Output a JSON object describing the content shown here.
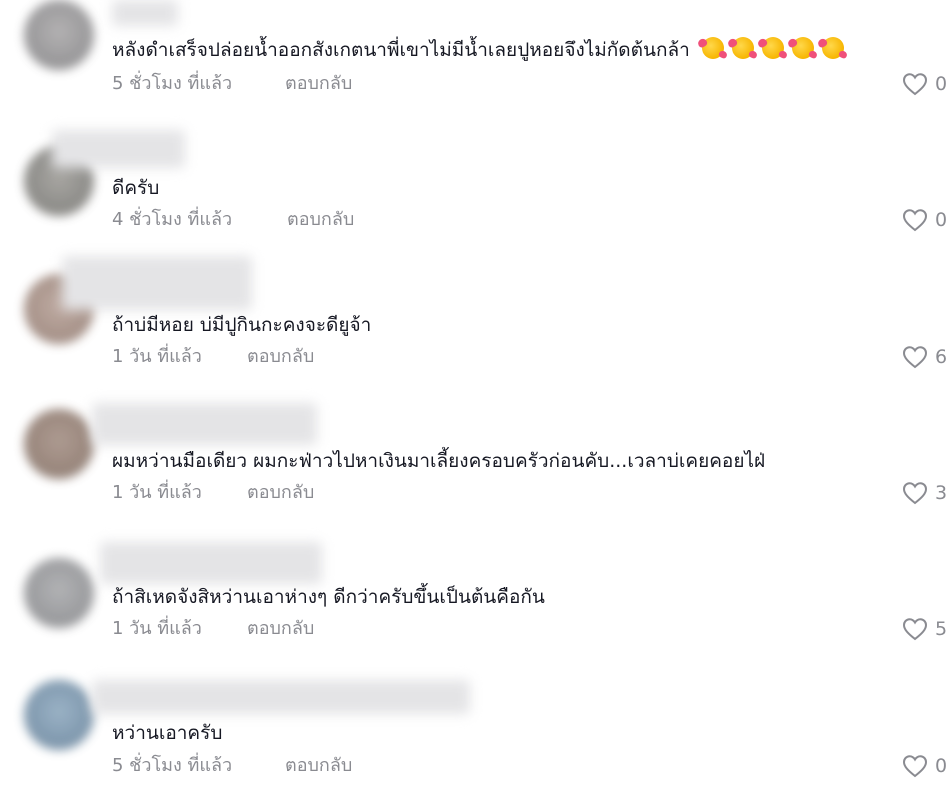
{
  "comments": [
    {
      "text": "หลังดำเสร็จปล่อยน้ำออกสังเกตนาพี่เขาไม่มีน้ำเลยปูหอยจึงไม่กัดต้นกล้า",
      "emoji_count": 5,
      "time": "5 ชั่วโมง ที่แล้ว",
      "reply": "ตอบกลับ",
      "likes": "0",
      "avatar_color": "#8b8a8c"
    },
    {
      "text": "ดีครับ",
      "time": "4 ชั่วโมง ที่แล้ว",
      "reply": "ตอบกลับ",
      "likes": "0",
      "avatar_color": "#7d7c78"
    },
    {
      "text": "ถ้าบ่มีหอย บ่มีปูกินกะคงจะดียูจ้า",
      "time": "1 วัน ที่แล้ว",
      "reply": "ตอบกลับ",
      "likes": "6",
      "avatar_color": "#9c8479"
    },
    {
      "text": "ผมหว่านมือเดียว ผมกะฟ่าวไปหาเงินมาเลี้ยงครอบครัวก่อนคับ...เวลาบ่เคยคอยไฝ่",
      "time": "1 วัน ที่แล้ว",
      "reply": "ตอบกลับ",
      "likes": "3",
      "avatar_color": "#8a7468"
    },
    {
      "text": "ถ้าสิเหดจังสิหว่านเอาห่างๆ ดีกว่าครับขึ้นเป็นต้นคือกัน",
      "time": "1 วัน ที่แล้ว",
      "reply": "ตอบกลับ",
      "likes": "5",
      "avatar_color": "#8c8d90"
    },
    {
      "text": "หว่านเอาครับ",
      "time": "5 ชั่วโมง ที่แล้ว",
      "reply": "ตอบกลับ",
      "likes": "0",
      "avatar_color": "#6d8aa3"
    }
  ],
  "icons": {
    "like": "heart-outline-icon",
    "emoji": "smiling-face-with-hearts-icon"
  },
  "colors": {
    "text": "#161823",
    "secondary": "#8a8b91",
    "heart_stroke": "#8a8b91"
  }
}
